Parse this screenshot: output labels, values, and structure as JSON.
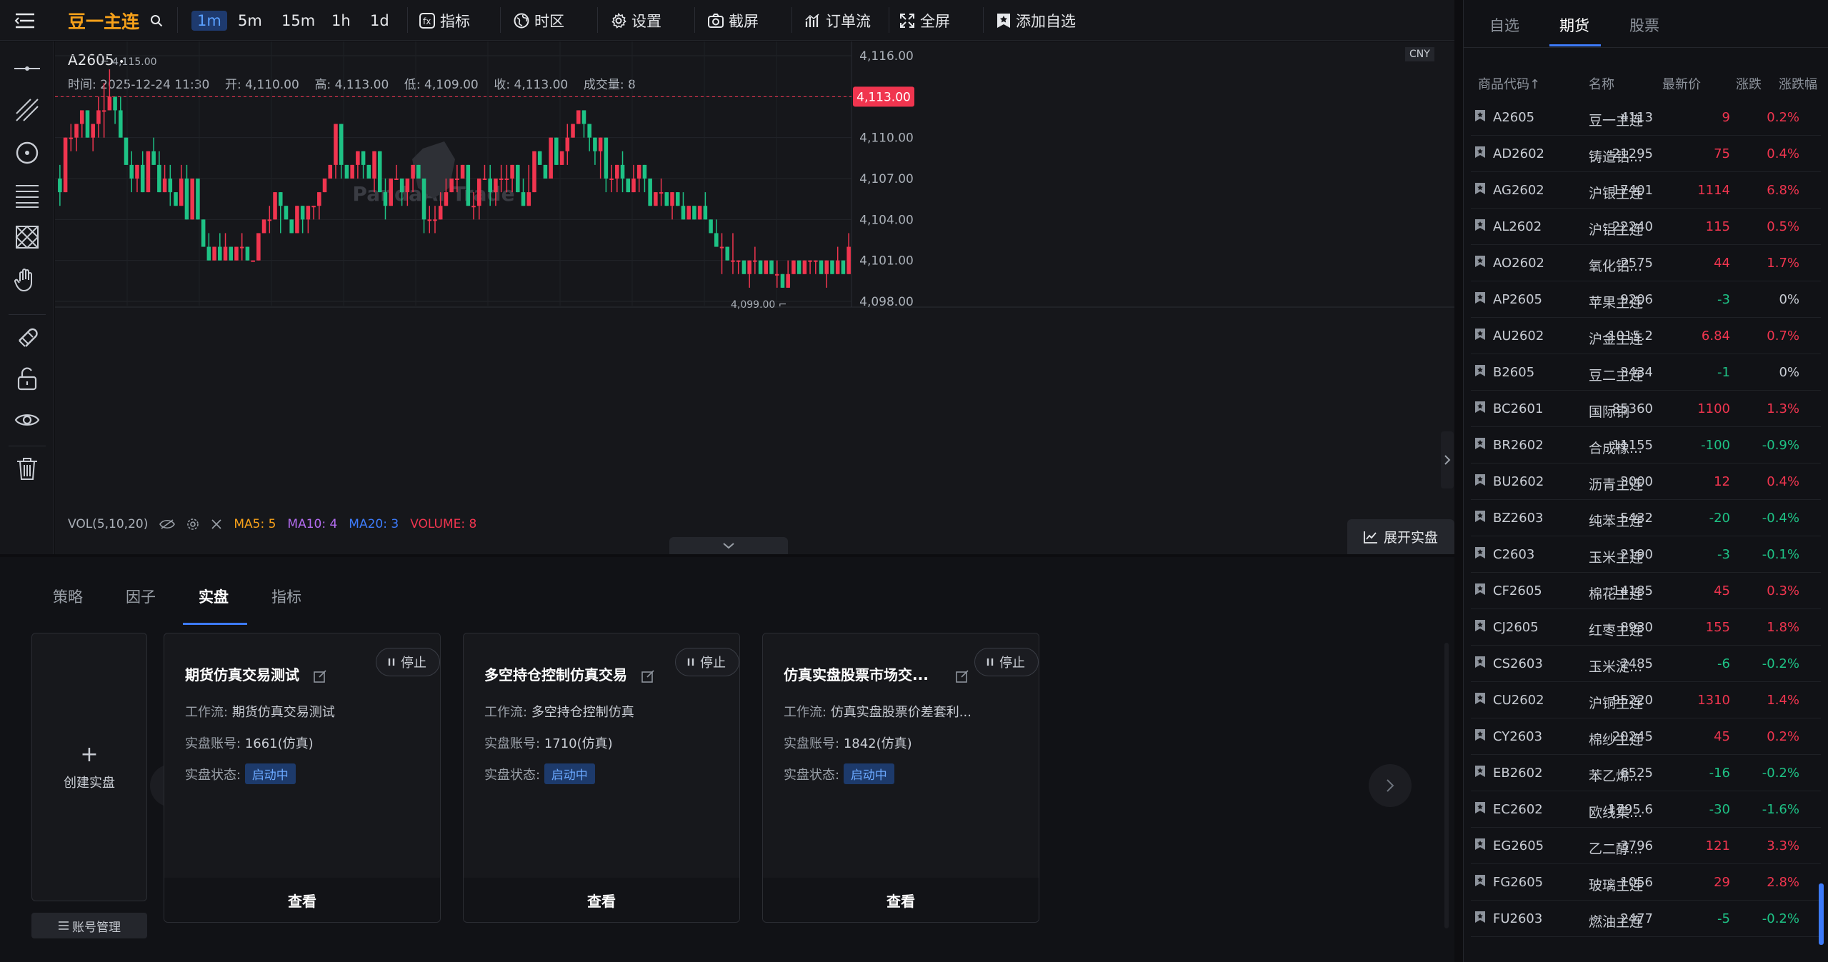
{
  "topbar": {
    "symbol_name": "豆一主连",
    "timeframes": [
      "1m",
      "5m",
      "15m",
      "1h",
      "1d"
    ],
    "active_timeframe": "1m",
    "indicator_label": "指标",
    "timezone_label": "时区",
    "settings_label": "设置",
    "screenshot_label": "截屏",
    "orderflow_label": "订单流",
    "fullscreen_label": "全屏",
    "add_watch_label": "添加自选"
  },
  "chart": {
    "symbol": "A2605",
    "dot": "•",
    "ohlc": {
      "time_label": "时间:",
      "time": "2025-12-24 11:30",
      "open_label": "开:",
      "open": "4,110.00",
      "high_label": "高:",
      "high": "4,113.00",
      "low_label": "低:",
      "low": "4,109.00",
      "close_label": "收:",
      "close": "4,113.00",
      "volume_label": "成交量:",
      "volume": "8"
    },
    "currency": "CNY",
    "price_ticks": [
      "4,116.00",
      "4,113.00",
      "4,110.00",
      "4,107.00",
      "4,104.00",
      "4,101.00",
      "4,098.00"
    ],
    "current_price_label": "4,113.00",
    "current_price": 4113,
    "y_min": 4098,
    "y_max": 4116,
    "max_marker": "4,115.00",
    "min_marker": "4,099.00",
    "watermark": "PandaAI Trade",
    "vol_label": "VOL(5,10,20)",
    "ma5": "MA5: 5",
    "ma10": "MA10: 4",
    "ma20": "MA20: 3",
    "volume_value": "VOLUME: 8",
    "expand_live_label": "展开实盘",
    "candles": [
      [
        4107,
        4108,
        4105,
        4106
      ],
      [
        4106,
        4110,
        4106,
        4110
      ],
      [
        4110,
        4111,
        4109,
        4110
      ],
      [
        4110,
        4111,
        4109,
        4111
      ],
      [
        4111,
        4112,
        4110,
        4112
      ],
      [
        4112,
        4112,
        4110,
        4110
      ],
      [
        4110,
        4111,
        4109,
        4111
      ],
      [
        4111,
        4113,
        4110,
        4112
      ],
      [
        4112,
        4114,
        4110,
        4112
      ],
      [
        4112,
        4115,
        4112,
        4113
      ],
      [
        4113,
        4113,
        4111,
        4112
      ],
      [
        4112,
        4113,
        4110,
        4110
      ],
      [
        4110,
        4110,
        4108,
        4108
      ],
      [
        4108,
        4109,
        4106,
        4107
      ],
      [
        4107,
        4108,
        4106,
        4108
      ],
      [
        4108,
        4109,
        4106,
        4106
      ],
      [
        4106,
        4109,
        4106,
        4109
      ],
      [
        4109,
        4110,
        4108,
        4108
      ],
      [
        4108,
        4109,
        4106,
        4106
      ],
      [
        4106,
        4108,
        4106,
        4107
      ],
      [
        4107,
        4108,
        4105,
        4106
      ],
      [
        4106,
        4106,
        4105,
        4105
      ],
      [
        4105,
        4108,
        4105,
        4107
      ],
      [
        4107,
        4108,
        4104,
        4104
      ],
      [
        4104,
        4107,
        4104,
        4107
      ],
      [
        4107,
        4107,
        4104,
        4104
      ],
      [
        4104,
        4104,
        4102,
        4102
      ],
      [
        4102,
        4103,
        4101,
        4101
      ],
      [
        4101,
        4102,
        4101,
        4102
      ],
      [
        4102,
        4103,
        4101,
        4101
      ],
      [
        4101,
        4103,
        4101,
        4102
      ],
      [
        4102,
        4102,
        4101,
        4101
      ],
      [
        4101,
        4102,
        4101,
        4102
      ],
      [
        4102,
        4103,
        4101,
        4102
      ],
      [
        4102,
        4102,
        4101,
        4101
      ],
      [
        4101,
        4101,
        4101,
        4101
      ],
      [
        4101,
        4103,
        4101,
        4103
      ],
      [
        4103,
        4104,
        4103,
        4104
      ],
      [
        4104,
        4105,
        4103,
        4104
      ],
      [
        4104,
        4106,
        4104,
        4106
      ],
      [
        4106,
        4106,
        4103,
        4105
      ],
      [
        4105,
        4105,
        4104,
        4104
      ],
      [
        4104,
        4104,
        4103,
        4103
      ],
      [
        4103,
        4105,
        4103,
        4105
      ],
      [
        4105,
        4105,
        4103,
        4104
      ],
      [
        4104,
        4105,
        4103,
        4105
      ],
      [
        4105,
        4105,
        4104,
        4105
      ],
      [
        4105,
        4106,
        4104,
        4106
      ],
      [
        4106,
        4107,
        4106,
        4107
      ],
      [
        4107,
        4108,
        4107,
        4108
      ],
      [
        4108,
        4111,
        4107,
        4111
      ],
      [
        4111,
        4111,
        4107,
        4108
      ],
      [
        4108,
        4108,
        4107,
        4107
      ],
      [
        4107,
        4108,
        4107,
        4108
      ],
      [
        4108,
        4109,
        4107,
        4109
      ],
      [
        4109,
        4109,
        4107,
        4108
      ],
      [
        4108,
        4108,
        4107,
        4107
      ],
      [
        4107,
        4109,
        4106,
        4109
      ],
      [
        4109,
        4109,
        4106,
        4106
      ],
      [
        4106,
        4107,
        4104,
        4105
      ],
      [
        4105,
        4107,
        4105,
        4107
      ],
      [
        4107,
        4108,
        4107,
        4107
      ],
      [
        4107,
        4107,
        4105,
        4106
      ],
      [
        4106,
        4107,
        4105,
        4107
      ],
      [
        4107,
        4108,
        4106,
        4108
      ],
      [
        4108,
        4108,
        4107,
        4107
      ],
      [
        4107,
        4107,
        4103,
        4104
      ],
      [
        4104,
        4105,
        4103,
        4104
      ],
      [
        4104,
        4105,
        4103,
        4104
      ],
      [
        4104,
        4106,
        4104,
        4105
      ],
      [
        4105,
        4107,
        4105,
        4106
      ],
      [
        4106,
        4107,
        4106,
        4107
      ],
      [
        4107,
        4108,
        4106,
        4107
      ],
      [
        4107,
        4108,
        4107,
        4108
      ],
      [
        4108,
        4108,
        4105,
        4105
      ],
      [
        4105,
        4106,
        4104,
        4105
      ],
      [
        4105,
        4107,
        4104,
        4107
      ],
      [
        4107,
        4108,
        4107,
        4107
      ],
      [
        4107,
        4108,
        4105,
        4106
      ],
      [
        4106,
        4107,
        4105,
        4107
      ],
      [
        4107,
        4108,
        4106,
        4107
      ],
      [
        4107,
        4108,
        4106,
        4107
      ],
      [
        4107,
        4108,
        4106,
        4108
      ],
      [
        4108,
        4108,
        4106,
        4106
      ],
      [
        4106,
        4107,
        4105,
        4105
      ],
      [
        4105,
        4108,
        4105,
        4106
      ],
      [
        4106,
        4109,
        4106,
        4109
      ],
      [
        4109,
        4109,
        4108,
        4108
      ],
      [
        4108,
        4108,
        4107,
        4107
      ],
      [
        4107,
        4110,
        4107,
        4110
      ],
      [
        4110,
        4110,
        4108,
        4108
      ],
      [
        4108,
        4109,
        4108,
        4109
      ],
      [
        4109,
        4111,
        4108,
        4110
      ],
      [
        4110,
        4111,
        4110,
        4111
      ],
      [
        4111,
        4112,
        4111,
        4112
      ],
      [
        4112,
        4112,
        4110,
        4111
      ],
      [
        4111,
        4111,
        4109,
        4110
      ],
      [
        4110,
        4110,
        4108,
        4109
      ],
      [
        4109,
        4110,
        4107,
        4110
      ],
      [
        4110,
        4110,
        4106,
        4107
      ],
      [
        4107,
        4108,
        4106,
        4107
      ],
      [
        4107,
        4108,
        4106,
        4108
      ],
      [
        4108,
        4109,
        4106,
        4107
      ],
      [
        4107,
        4107,
        4106,
        4106
      ],
      [
        4106,
        4108,
        4106,
        4107
      ],
      [
        4107,
        4108,
        4106,
        4108
      ],
      [
        4108,
        4108,
        4106,
        4107
      ],
      [
        4107,
        4107,
        4105,
        4105
      ],
      [
        4105,
        4106,
        4105,
        4106
      ],
      [
        4106,
        4107,
        4105,
        4106
      ],
      [
        4106,
        4106,
        4105,
        4105
      ],
      [
        4105,
        4106,
        4104,
        4106
      ],
      [
        4106,
        4106,
        4105,
        4105
      ],
      [
        4105,
        4106,
        4104,
        4104
      ],
      [
        4104,
        4105,
        4104,
        4105
      ],
      [
        4105,
        4105,
        4104,
        4104
      ],
      [
        4104,
        4105,
        4104,
        4105
      ],
      [
        4105,
        4106,
        4104,
        4104
      ],
      [
        4104,
        4104,
        4103,
        4103
      ],
      [
        4103,
        4104,
        4102,
        4102
      ],
      [
        4102,
        4103,
        4100,
        4102
      ],
      [
        4102,
        4102,
        4101,
        4101
      ],
      [
        4101,
        4103,
        4100,
        4101
      ],
      [
        4101,
        4101,
        4100,
        4101
      ],
      [
        4101,
        4101,
        4100,
        4100
      ],
      [
        4100,
        4101,
        4099,
        4101
      ],
      [
        4101,
        4102,
        4100,
        4101
      ],
      [
        4101,
        4101,
        4100,
        4100
      ],
      [
        4100,
        4101,
        4100,
        4101
      ],
      [
        4101,
        4101,
        4100,
        4100
      ],
      [
        4100,
        4101,
        4099,
        4100
      ],
      [
        4100,
        4100,
        4099,
        4099
      ],
      [
        4099,
        4101,
        4099,
        4100
      ],
      [
        4100,
        4101,
        4100,
        4101
      ],
      [
        4101,
        4101,
        4100,
        4100
      ],
      [
        4100,
        4101,
        4100,
        4101
      ],
      [
        4101,
        4101,
        4100,
        4101
      ],
      [
        4101,
        4101,
        4100,
        4101
      ],
      [
        4101,
        4101,
        4100,
        4100
      ],
      [
        4100,
        4101,
        4099,
        4101
      ],
      [
        4101,
        4101,
        4100,
        4100
      ],
      [
        4100,
        4102,
        4100,
        4101
      ],
      [
        4101,
        4101,
        4100,
        4100
      ],
      [
        4100,
        4103,
        4100,
        4102
      ]
    ]
  },
  "bottom": {
    "tabs": [
      "策略",
      "因子",
      "实盘",
      "指标"
    ],
    "active_tab": "实盘",
    "create_label": "创建实盘",
    "plus": "+",
    "account_mgmt_label": "账号管理",
    "stop_label": "停止",
    "view_label": "查看",
    "workflow_label": "工作流:",
    "account_label": "实盘账号:",
    "status_label": "实盘状态:",
    "cards": [
      {
        "title": "期货仿真交易测试",
        "workflow": "期货仿真交易测试",
        "account": "1661(仿真)",
        "status": "启动中"
      },
      {
        "title": "多空持仓控制仿真交易",
        "workflow": "多空持仓控制仿真",
        "account": "1710(仿真)",
        "status": "启动中"
      },
      {
        "title": "仿真实盘股票市场交...",
        "workflow": "仿真实盘股票价差套利...",
        "account": "1842(仿真)",
        "status": "启动中"
      }
    ]
  },
  "right": {
    "tabs": [
      "自选",
      "期货",
      "股票"
    ],
    "active_tab": "期货",
    "headers": {
      "code": "商品代码↑",
      "name": "名称",
      "last": "最新价",
      "chg": "涨跌",
      "pct": "涨跌幅"
    },
    "rows": [
      {
        "code": "A2605",
        "name": "豆一主连",
        "last": "4113",
        "chg": "9",
        "pct": "0.2%",
        "dir": "up"
      },
      {
        "code": "AD2602",
        "name": "铸造铝...",
        "last": "21295",
        "chg": "75",
        "pct": "0.4%",
        "dir": "up"
      },
      {
        "code": "AG2602",
        "name": "沪银主连",
        "last": "17401",
        "chg": "1114",
        "pct": "6.8%",
        "dir": "up"
      },
      {
        "code": "AL2602",
        "name": "沪铝主连",
        "last": "22240",
        "chg": "115",
        "pct": "0.5%",
        "dir": "up"
      },
      {
        "code": "AO2602",
        "name": "氧化铝...",
        "last": "2575",
        "chg": "44",
        "pct": "1.7%",
        "dir": "up"
      },
      {
        "code": "AP2605",
        "name": "苹果主连",
        "last": "9206",
        "chg": "-3",
        "pct": "0%",
        "dir": "dnz"
      },
      {
        "code": "AU2602",
        "name": "沪金主连",
        "last": "1015.2",
        "chg": "6.84",
        "pct": "0.7%",
        "dir": "up"
      },
      {
        "code": "B2605",
        "name": "豆二主连",
        "last": "3434",
        "chg": "-1",
        "pct": "0%",
        "dir": "dnz"
      },
      {
        "code": "BC2601",
        "name": "国际铜",
        "last": "85360",
        "chg": "1100",
        "pct": "1.3%",
        "dir": "up"
      },
      {
        "code": "BR2602",
        "name": "合成橡...",
        "last": "11155",
        "chg": "-100",
        "pct": "-0.9%",
        "dir": "dn"
      },
      {
        "code": "BU2602",
        "name": "沥青主连",
        "last": "3000",
        "chg": "12",
        "pct": "0.4%",
        "dir": "up"
      },
      {
        "code": "BZ2603",
        "name": "纯苯主连",
        "last": "5432",
        "chg": "-20",
        "pct": "-0.4%",
        "dir": "dn"
      },
      {
        "code": "C2603",
        "name": "玉米主连",
        "last": "2190",
        "chg": "-3",
        "pct": "-0.1%",
        "dir": "dn"
      },
      {
        "code": "CF2605",
        "name": "棉花主连",
        "last": "14185",
        "chg": "45",
        "pct": "0.3%",
        "dir": "up"
      },
      {
        "code": "CJ2605",
        "name": "红枣主连",
        "last": "8930",
        "chg": "155",
        "pct": "1.8%",
        "dir": "up"
      },
      {
        "code": "CS2603",
        "name": "玉米淀...",
        "last": "2485",
        "chg": "-6",
        "pct": "-0.2%",
        "dir": "dn"
      },
      {
        "code": "CU2602",
        "name": "沪铜主连",
        "last": "95220",
        "chg": "1310",
        "pct": "1.4%",
        "dir": "up"
      },
      {
        "code": "CY2603",
        "name": "棉纱主连",
        "last": "20245",
        "chg": "45",
        "pct": "0.2%",
        "dir": "up"
      },
      {
        "code": "EB2602",
        "name": "苯乙烯...",
        "last": "6525",
        "chg": "-16",
        "pct": "-0.2%",
        "dir": "dn"
      },
      {
        "code": "EC2602",
        "name": "欧线集...",
        "last": "1795.6",
        "chg": "-30",
        "pct": "-1.6%",
        "dir": "dn"
      },
      {
        "code": "EG2605",
        "name": "乙二醇...",
        "last": "3796",
        "chg": "121",
        "pct": "3.3%",
        "dir": "up"
      },
      {
        "code": "FG2605",
        "name": "玻璃主连",
        "last": "1056",
        "chg": "29",
        "pct": "2.8%",
        "dir": "up"
      },
      {
        "code": "FU2603",
        "name": "燃油主连",
        "last": "2477",
        "chg": "-5",
        "pct": "-0.2%",
        "dir": "dn"
      }
    ]
  },
  "colors": {
    "up": "#f0354f",
    "down": "#1ec285",
    "accent": "#3d7bfa",
    "brand": "#f7a11a"
  }
}
